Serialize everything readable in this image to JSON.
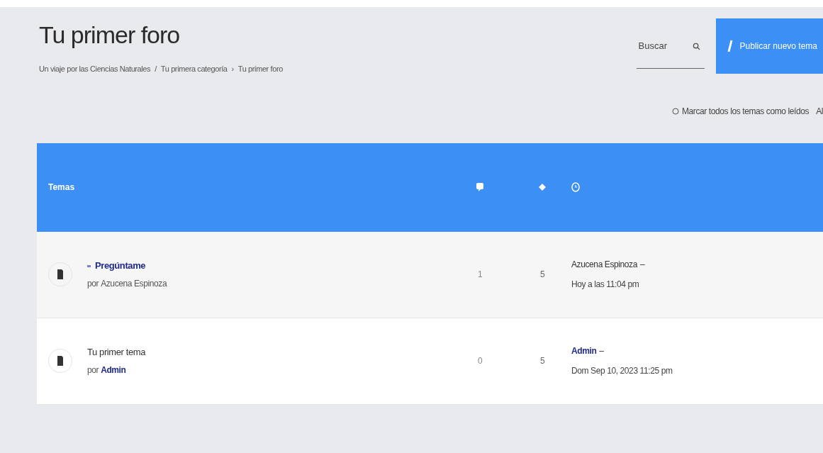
{
  "title": "Tu primer foro",
  "breadcrumb": [
    "Un viaje por las Ciencias Naturales",
    "Tu primera categoría",
    "Tu primer foro"
  ],
  "breadcrumb_separators": [
    "/",
    "›"
  ],
  "search": {
    "placeholder": "Buscar"
  },
  "new_topic_button": "Publicar nuevo tema",
  "mark_read": "Marcar todos los temas como leídos",
  "actions_cut": "Al",
  "table": {
    "columns": [
      "Temas"
    ],
    "rows": [
      {
        "kind": "sticky",
        "title": "Pregúntame",
        "by": "por",
        "author": "Azucena Espinoza",
        "author_admin": false,
        "replies": "1",
        "views": "5",
        "last_author": "Azucena Espinoza",
        "last_author_admin": false,
        "last_sep": "–",
        "last_time": "Hoy a las 11:04 pm"
      },
      {
        "kind": "normal",
        "title": "Tu primer tema",
        "by": "por",
        "author": "Admin",
        "author_admin": true,
        "replies": "0",
        "views": "5",
        "last_author": "Admin",
        "last_author_admin": true,
        "last_sep": "–",
        "last_time": "Dom Sep 10, 2023 11:25 pm"
      }
    ]
  }
}
